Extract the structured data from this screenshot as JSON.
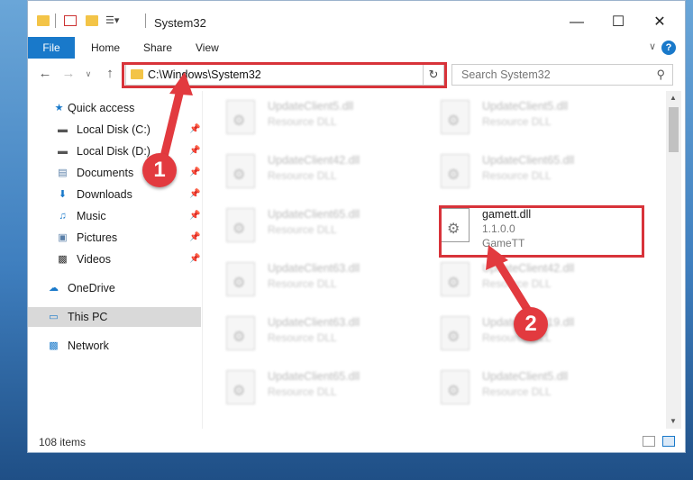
{
  "window": {
    "title": "System32",
    "controls": {
      "minimize": "—",
      "maximize": "☐",
      "close": "✕"
    }
  },
  "ribbon": {
    "tabs": [
      "File",
      "Home",
      "Share",
      "View"
    ],
    "help": "?"
  },
  "nav": {
    "address": "C:\\Windows\\System32",
    "search_placeholder": "Search System32"
  },
  "sidebar": {
    "items": [
      {
        "label": "Quick access",
        "icon": "star-icon",
        "pinned": false
      },
      {
        "label": "Local Disk (C:)",
        "icon": "drive-icon",
        "pinned": true
      },
      {
        "label": "Local Disk (D:)",
        "icon": "drive-icon",
        "pinned": true
      },
      {
        "label": "Documents",
        "icon": "documents-icon",
        "pinned": true
      },
      {
        "label": "Downloads",
        "icon": "download-icon",
        "pinned": true
      },
      {
        "label": "Music",
        "icon": "music-icon",
        "pinned": true
      },
      {
        "label": "Pictures",
        "icon": "pictures-icon",
        "pinned": true
      },
      {
        "label": "Videos",
        "icon": "videos-icon",
        "pinned": true
      },
      {
        "label": "OneDrive",
        "icon": "cloud-icon",
        "pinned": false
      },
      {
        "label": "This PC",
        "icon": "computer-icon",
        "pinned": false,
        "selected": true
      },
      {
        "label": "Network",
        "icon": "network-icon",
        "pinned": false
      }
    ]
  },
  "files": [
    {
      "name": "UpdateClient5.dll",
      "desc": "Resource DLL"
    },
    {
      "name": "UpdateClient5.dll",
      "desc": "Resource DLL"
    },
    {
      "name": "UpdateClient42.dll",
      "desc": "Resource DLL"
    },
    {
      "name": "UpdateClient65.dll",
      "desc": "Resource DLL"
    },
    {
      "name": "UpdateClient65.dll",
      "desc": "Resource DLL"
    },
    {
      "name": "gamett.dll",
      "desc": "1.1.0.0",
      "company": "GameTT"
    },
    {
      "name": "UpdateClient63.dll",
      "desc": "Resource DLL"
    },
    {
      "name": "UpdateClient42.dll",
      "desc": "Resource DLL"
    },
    {
      "name": "UpdateClient63.dll",
      "desc": "Resource DLL"
    },
    {
      "name": "UpdateClient19.dll",
      "desc": "Resource DLL"
    },
    {
      "name": "UpdateClient65.dll",
      "desc": "Resource DLL"
    },
    {
      "name": "UpdateClient5.dll",
      "desc": "Resource DLL"
    }
  ],
  "status": {
    "item_count": "108 items"
  },
  "annotations": {
    "step1": "1",
    "step2": "2",
    "color": "#d8333a"
  }
}
